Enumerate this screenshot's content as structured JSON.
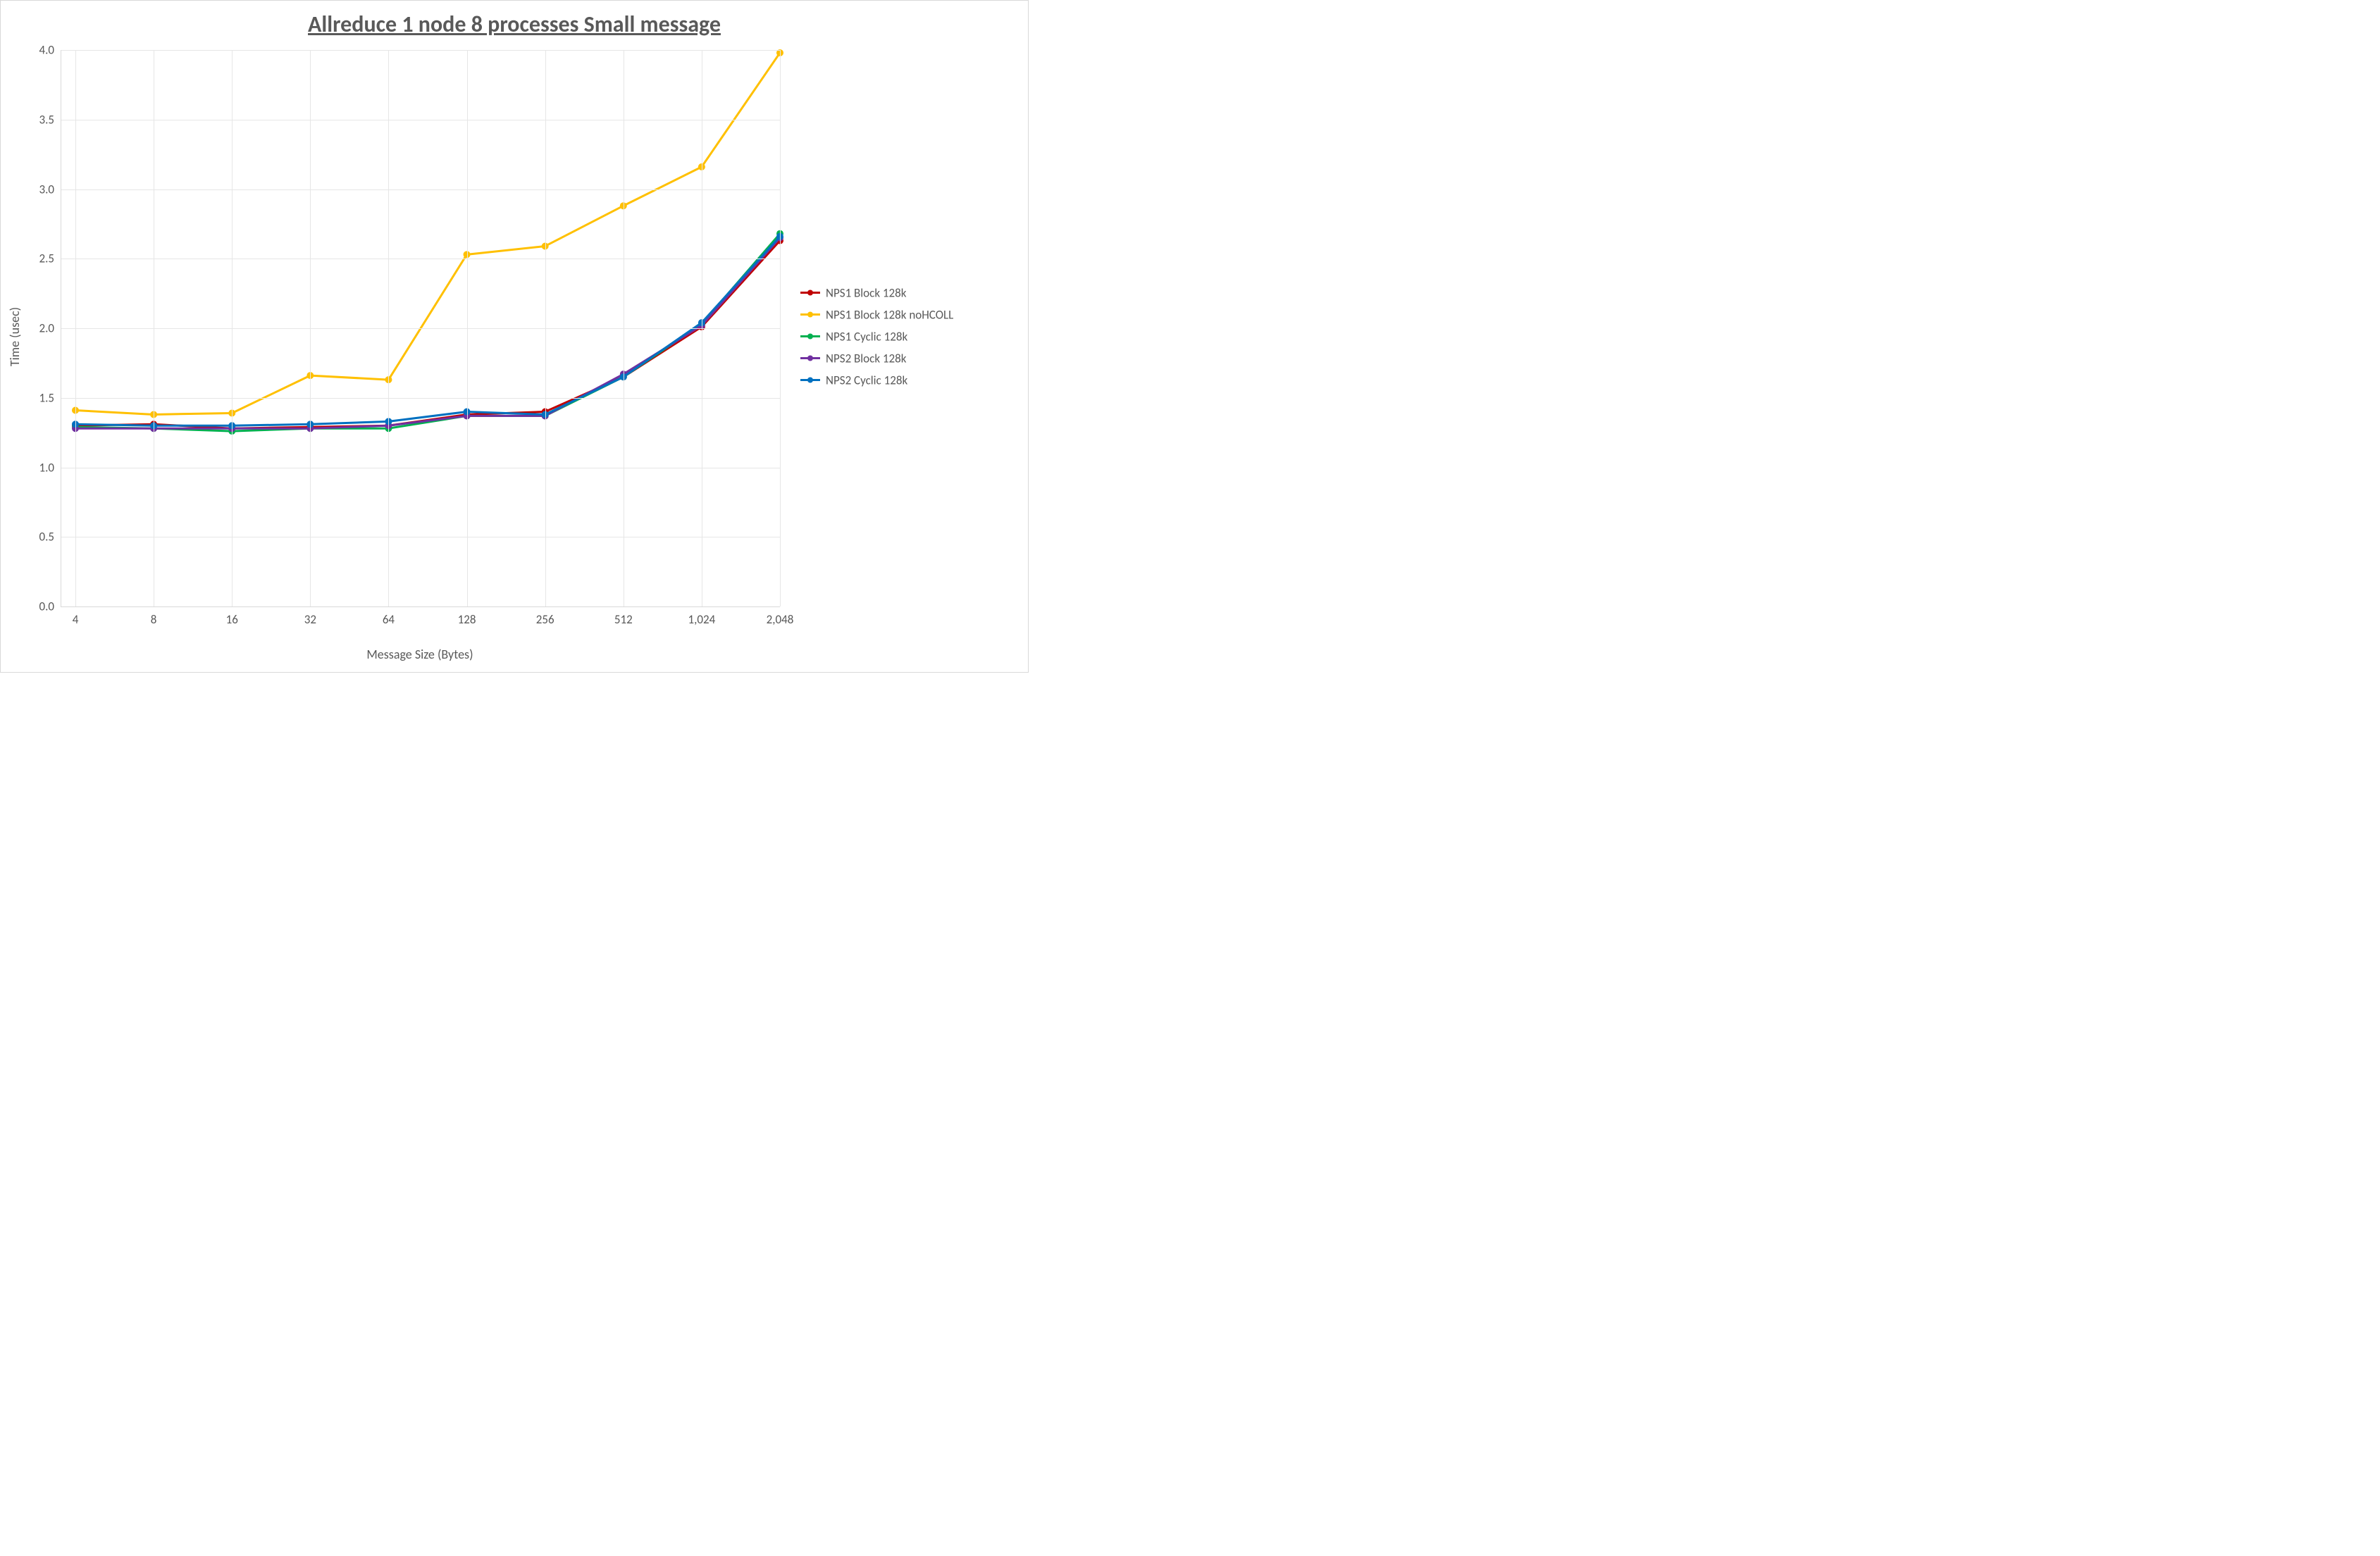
{
  "chart_data": {
    "type": "line",
    "title": "Allreduce 1 node 8 processes Small message",
    "xlabel": "Message Size (Bytes)",
    "ylabel": "Time (usec)",
    "ylim": [
      0.0,
      4.0
    ],
    "y_ticks": [
      0.0,
      0.5,
      1.0,
      1.5,
      2.0,
      2.5,
      3.0,
      3.5,
      4.0
    ],
    "x_tick_labels": [
      "4",
      "8",
      "16",
      "32",
      "64",
      "128",
      "256",
      "512",
      "1,024",
      "2,048"
    ],
    "categories": [
      4,
      8,
      16,
      32,
      64,
      128,
      256,
      512,
      1024,
      2048
    ],
    "legend_position": "right",
    "grid": true,
    "series": [
      {
        "name": "NPS1 Block 128k",
        "color": "#c00000",
        "values": [
          1.3,
          1.31,
          1.28,
          1.29,
          1.3,
          1.38,
          1.4,
          1.65,
          2.01,
          2.63
        ]
      },
      {
        "name": "NPS1 Block 128k noHCOLL",
        "color": "#ffc000",
        "values": [
          1.41,
          1.38,
          1.39,
          1.66,
          1.63,
          2.53,
          2.59,
          2.88,
          3.16,
          3.98
        ]
      },
      {
        "name": "NPS1 Cyclic 128k",
        "color": "#00b050",
        "values": [
          1.29,
          1.28,
          1.26,
          1.28,
          1.28,
          1.37,
          1.37,
          1.65,
          2.03,
          2.68
        ]
      },
      {
        "name": "NPS2 Block 128k",
        "color": "#7030a0",
        "values": [
          1.28,
          1.28,
          1.28,
          1.28,
          1.3,
          1.37,
          1.37,
          1.67,
          2.02,
          2.65
        ]
      },
      {
        "name": "NPS2 Cyclic 128k",
        "color": "#0070c0",
        "values": [
          1.31,
          1.3,
          1.3,
          1.31,
          1.33,
          1.4,
          1.38,
          1.65,
          2.04,
          2.66
        ]
      }
    ]
  }
}
